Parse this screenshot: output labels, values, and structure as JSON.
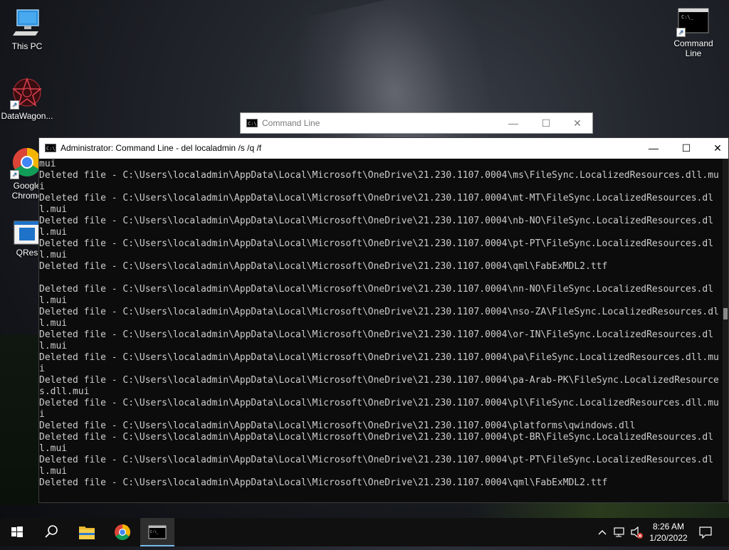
{
  "desktop": {
    "icons": [
      {
        "label": "This PC"
      },
      {
        "label": "DataWagon..."
      },
      {
        "label": "Google Chrome"
      },
      {
        "label": "QRes"
      },
      {
        "label": "Command Line"
      }
    ]
  },
  "background_window": {
    "title": "Command Line",
    "minimize": "—",
    "maximize": "☐",
    "close": "✕"
  },
  "console_window": {
    "title": "Administrator: Command Line - del  localadmin /s /q /f",
    "minimize": "—",
    "maximize": "☐",
    "close": "✕",
    "lines": [
      "mui",
      "Deleted file - C:\\Users\\localadmin\\AppData\\Local\\Microsoft\\OneDrive\\21.230.1107.0004\\ms\\FileSync.LocalizedResources.dll.mui",
      "Deleted file - C:\\Users\\localadmin\\AppData\\Local\\Microsoft\\OneDrive\\21.230.1107.0004\\mt-MT\\FileSync.LocalizedResources.dll.mui",
      "Deleted file - C:\\Users\\localadmin\\AppData\\Local\\Microsoft\\OneDrive\\21.230.1107.0004\\nb-NO\\FileSync.LocalizedResources.dll.mui",
      "Deleted file - C:\\Users\\localadmin\\AppData\\Local\\Microsoft\\OneDrive\\21.230.1107.0004\\pt-PT\\FileSync.LocalizedResources.dll.mui",
      "Deleted file - C:\\Users\\localadmin\\AppData\\Local\\Microsoft\\OneDrive\\21.230.1107.0004\\qml\\FabExMDL2.ttf",
      "",
      "Deleted file - C:\\Users\\localadmin\\AppData\\Local\\Microsoft\\OneDrive\\21.230.1107.0004\\nn-NO\\FileSync.LocalizedResources.dll.mui",
      "Deleted file - C:\\Users\\localadmin\\AppData\\Local\\Microsoft\\OneDrive\\21.230.1107.0004\\nso-ZA\\FileSync.LocalizedResources.dll.mui",
      "Deleted file - C:\\Users\\localadmin\\AppData\\Local\\Microsoft\\OneDrive\\21.230.1107.0004\\or-IN\\FileSync.LocalizedResources.dll.mui",
      "Deleted file - C:\\Users\\localadmin\\AppData\\Local\\Microsoft\\OneDrive\\21.230.1107.0004\\pa\\FileSync.LocalizedResources.dll.mui",
      "Deleted file - C:\\Users\\localadmin\\AppData\\Local\\Microsoft\\OneDrive\\21.230.1107.0004\\pa-Arab-PK\\FileSync.LocalizedResources.dll.mui",
      "Deleted file - C:\\Users\\localadmin\\AppData\\Local\\Microsoft\\OneDrive\\21.230.1107.0004\\pl\\FileSync.LocalizedResources.dll.mui",
      "Deleted file - C:\\Users\\localadmin\\AppData\\Local\\Microsoft\\OneDrive\\21.230.1107.0004\\platforms\\qwindows.dll",
      "Deleted file - C:\\Users\\localadmin\\AppData\\Local\\Microsoft\\OneDrive\\21.230.1107.0004\\pt-BR\\FileSync.LocalizedResources.dll.mui",
      "Deleted file - C:\\Users\\localadmin\\AppData\\Local\\Microsoft\\OneDrive\\21.230.1107.0004\\pt-PT\\FileSync.LocalizedResources.dll.mui",
      "Deleted file - C:\\Users\\localadmin\\AppData\\Local\\Microsoft\\OneDrive\\21.230.1107.0004\\qml\\FabExMDL2.ttf"
    ]
  },
  "taskbar": {
    "items": [
      {
        "name": "start-icon"
      },
      {
        "name": "search-icon"
      },
      {
        "name": "file-explorer-icon"
      },
      {
        "name": "chrome-icon"
      },
      {
        "name": "command-line-icon",
        "active": true
      }
    ],
    "tray_icons": [
      "chevron-up-icon",
      "network-icon",
      "volume-muted-icon",
      "notification-icon"
    ],
    "time": "8:26 AM",
    "date": "1/20/2022"
  },
  "colors": {
    "console_bg": "#0c0c0c",
    "console_text": "#cccccc",
    "taskbar_bg": "#101010",
    "active_indicator": "#76b9ed"
  }
}
